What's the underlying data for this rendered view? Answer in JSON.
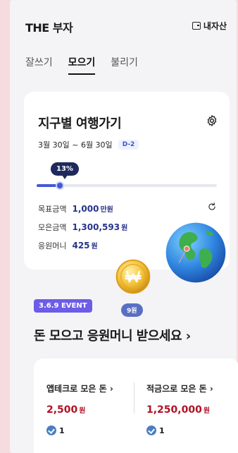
{
  "header": {
    "title": "THE 부자",
    "assets_label": "내자산"
  },
  "tabs": [
    {
      "label": "잘쓰기",
      "active": false
    },
    {
      "label": "모으기",
      "active": true
    },
    {
      "label": "불리기",
      "active": false
    }
  ],
  "goal": {
    "title": "지구별 여행가기",
    "period": "3월 30일 ~ 6월 30일",
    "dday": "D-2",
    "progress_label": "13%",
    "progress_fraction": 0.13,
    "rows": [
      {
        "label": "목표금액",
        "value": "1,000",
        "unit": "만원"
      },
      {
        "label": "모은금액",
        "value": "1,300,593",
        "unit": "원"
      },
      {
        "label": "응원머니",
        "value": "425",
        "unit": "원"
      }
    ]
  },
  "promo": {
    "event_badge": "3.6.9 EVENT",
    "won_pill": "9원",
    "headline": "돈 모으고 응원머니 받으세요 ›"
  },
  "summary": {
    "left": {
      "title": "앱테크로 모은 돈 ›",
      "amount": "2,500",
      "unit": "원",
      "count": "1"
    },
    "right": {
      "title": "적금으로 모은 돈 ›",
      "amount": "1,250,000",
      "unit": "원",
      "count": "1"
    }
  },
  "colors": {
    "accent": "#4558d6",
    "amount_red": "#b11226",
    "navy": "#27348b"
  }
}
